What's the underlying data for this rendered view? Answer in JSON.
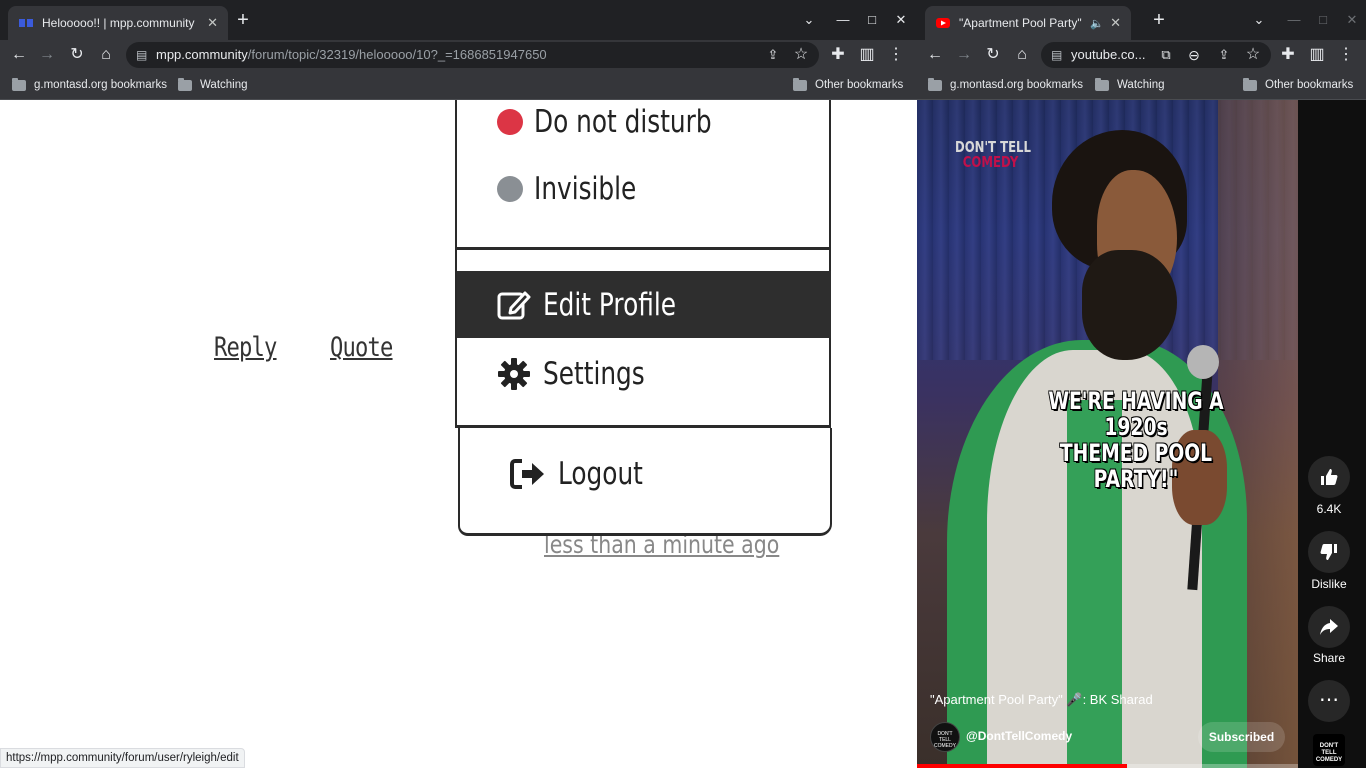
{
  "left_window": {
    "tab": {
      "title": "Helooooo!! | mpp.community"
    },
    "url": {
      "domain": "mpp.community",
      "path": "/forum/topic/32319/helooooo/10?_=1686851947650"
    },
    "bookmarks": {
      "item1": "g.montasd.org bookmarks",
      "item2": "Watching",
      "other": "Other bookmarks"
    },
    "page": {
      "reply": "Reply",
      "quote": "Quote",
      "timestamp": "less than a minute ago",
      "menu": {
        "status_dnd": "Do not disturb",
        "status_invisible": "Invisible",
        "edit_profile": "Edit Profile",
        "settings": "Settings",
        "logout": "Logout"
      }
    },
    "status_bar": "https://mpp.community/forum/user/ryleigh/edit"
  },
  "right_window": {
    "tab": {
      "title": "\"Apartment Pool Party\" 🎤 BK Sharad"
    },
    "url": {
      "domain": "youtube.co..."
    },
    "bookmarks": {
      "item1": "g.montasd.org bookmarks",
      "item2": "Watching",
      "other": "Other bookmarks"
    },
    "video": {
      "logo_line1": "DON'T TELL",
      "logo_line2": "COMEDY",
      "caption_line1": "WE'RE HAVING A 1920s",
      "caption_line2": "THEMED POOL PARTY!\"",
      "title": "\"Apartment Pool Party\" 🎤: BK Sharad",
      "channel": "@DontTellComedy",
      "channel_avatar_text": "DON'T TELL COMEDY",
      "subscribe": "Subscribed",
      "progress": 0.55
    },
    "actions": {
      "likes": "6.4K",
      "dislike": "Dislike",
      "share": "Share"
    }
  },
  "colors": {
    "dnd": "#dc3545",
    "invisible": "#8a8f94",
    "chrome_dark": "#202124",
    "chrome_toolbar": "#35363a"
  }
}
